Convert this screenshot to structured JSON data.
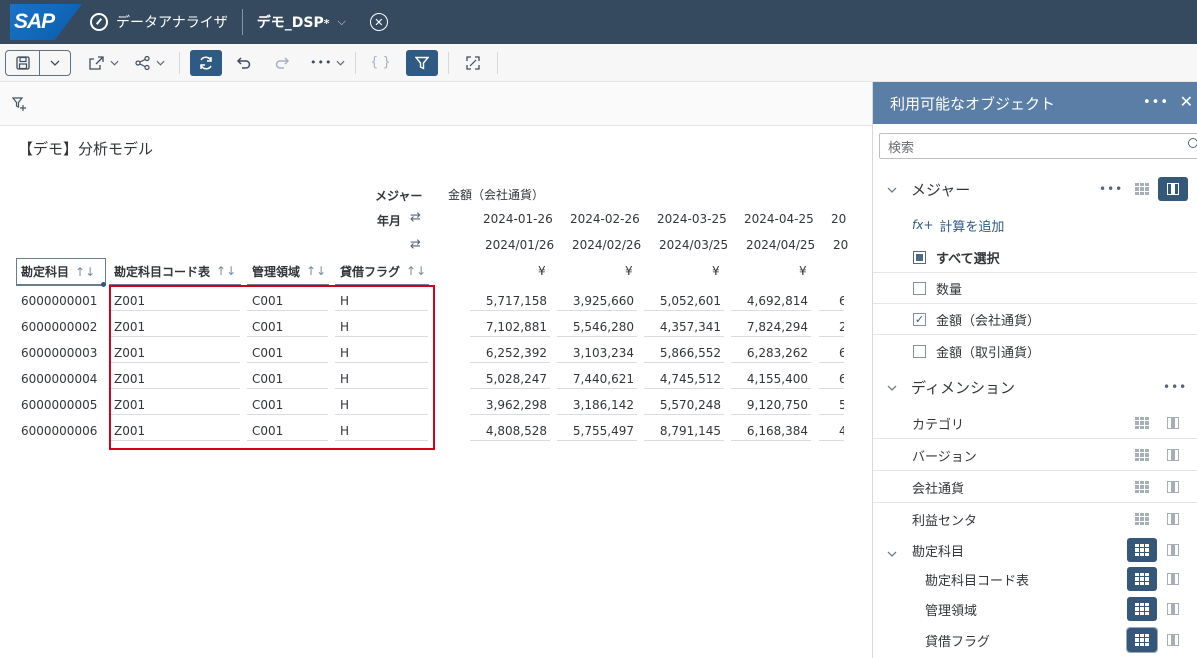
{
  "shell": {
    "logo": "SAP",
    "app_title": "データアナライザ",
    "doc_title": "デモ_DSP",
    "doc_modified": "*",
    "chevron": "⌵",
    "close": "✕"
  },
  "toolbar": {
    "save_icon": "🖫",
    "share_icon": "⇱",
    "more": "•••"
  },
  "main": {
    "model_title": "【デモ】分析モデル",
    "measure_label": "メジャー",
    "measure_value": "金額（会社通貨）",
    "yearmonth_label": "年月",
    "dates_top": [
      "2024-01-26",
      "2024-02-26",
      "2024-03-25",
      "2024-04-25",
      "20"
    ],
    "dates_bottom": [
      "2024/01/26",
      "2024/02/26",
      "2024/03/25",
      "2024/04/25",
      "20"
    ],
    "currency": [
      "¥",
      "¥",
      "¥",
      "¥"
    ],
    "dim_headers": [
      "勘定科目",
      "勘定科目コード表",
      "管理領域",
      "貸借フラグ"
    ],
    "sort_icon": "↑↓",
    "swap_icon": "⇄",
    "rows": [
      {
        "account": "6000000001",
        "chart": "Z001",
        "area": "C001",
        "flag": "H",
        "v1": "5,717,158",
        "v2": "3,925,660",
        "v3": "5,052,601",
        "v4": "4,692,814",
        "v5": "6"
      },
      {
        "account": "6000000002",
        "chart": "Z001",
        "area": "C001",
        "flag": "H",
        "v1": "7,102,881",
        "v2": "5,546,280",
        "v3": "4,357,341",
        "v4": "7,824,294",
        "v5": "2"
      },
      {
        "account": "6000000003",
        "chart": "Z001",
        "area": "C001",
        "flag": "H",
        "v1": "6,252,392",
        "v2": "3,103,234",
        "v3": "5,866,552",
        "v4": "6,283,262",
        "v5": "6"
      },
      {
        "account": "6000000004",
        "chart": "Z001",
        "area": "C001",
        "flag": "H",
        "v1": "5,028,247",
        "v2": "7,440,621",
        "v3": "4,745,512",
        "v4": "4,155,400",
        "v5": "6"
      },
      {
        "account": "6000000005",
        "chart": "Z001",
        "area": "C001",
        "flag": "H",
        "v1": "3,962,298",
        "v2": "3,186,142",
        "v3": "5,570,248",
        "v4": "9,120,750",
        "v5": "5"
      },
      {
        "account": "6000000006",
        "chart": "Z001",
        "area": "C001",
        "flag": "H",
        "v1": "4,808,528",
        "v2": "5,755,497",
        "v3": "8,791,145",
        "v4": "6,168,384",
        "v5": "4"
      }
    ]
  },
  "panel": {
    "title": "利用可能なオブジェクト",
    "more": "•••",
    "close": "✕",
    "search_placeholder": "検索",
    "measures_title": "メジャー",
    "add_calc": "計算を追加",
    "fx_icon": "fx+",
    "select_all": "すべて選択",
    "measures": [
      "数量",
      "金額（会社通貨）",
      "金額（取引通貨）"
    ],
    "dimensions_title": "ディメンション",
    "dimensions": [
      "カテゴリ",
      "バージョン",
      "会社通貨",
      "利益センタ",
      "勘定科目"
    ],
    "sub_dimensions": [
      "勘定科目コード表",
      "管理領域",
      "貸借フラグ"
    ]
  }
}
